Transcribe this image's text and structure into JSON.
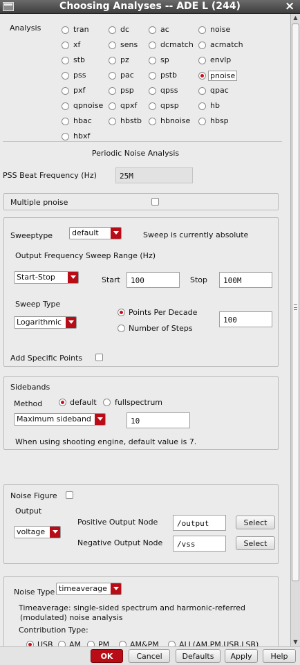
{
  "window": {
    "title": "Choosing Analyses -- ADE L (244)"
  },
  "analysis": {
    "label": "Analysis",
    "options": [
      "tran",
      "dc",
      "ac",
      "noise",
      "xf",
      "sens",
      "dcmatch",
      "acmatch",
      "stb",
      "pz",
      "sp",
      "envlp",
      "pss",
      "pac",
      "pstb",
      "pnoise",
      "pxf",
      "psp",
      "qpss",
      "qpac",
      "qpnoise",
      "qpxf",
      "qpsp",
      "hb",
      "hbac",
      "hbstb",
      "hbnoise",
      "hbsp",
      "hbxf"
    ],
    "selected": "pnoise"
  },
  "section_title": "Periodic Noise Analysis",
  "pss_beat": {
    "label": "PSS Beat Frequency (Hz)",
    "value": "25M"
  },
  "multiple_pnoise": {
    "label": "Multiple pnoise"
  },
  "sweep": {
    "sweeptype_label": "Sweeptype",
    "sweeptype_value": "default",
    "absolute_note": "Sweep is currently absolute",
    "range_label": "Output Frequency Sweep Range (Hz)",
    "range_mode": "Start-Stop",
    "start_label": "Start",
    "start_value": "100",
    "stop_label": "Stop",
    "stop_value": "100M",
    "sweep_type_label": "Sweep Type",
    "sweep_type_value": "Logarithmic",
    "ppd_label": "Points Per Decade",
    "steps_label": "Number of Steps",
    "points_value": "100",
    "specific_points_label": "Add Specific Points"
  },
  "sidebands": {
    "title": "Sidebands",
    "method_label": "Method",
    "method_default": "default",
    "method_full": "fullspectrum",
    "maxsb_mode": "Maximum sideband",
    "maxsb_value": "10",
    "note": "When using shooting engine, default value is 7."
  },
  "noise_figure": {
    "label": "Noise Figure",
    "output_label": "Output",
    "output_mode": "voltage",
    "pos_label": "Positive Output Node",
    "pos_value": "/output",
    "neg_label": "Negative Output Node",
    "neg_value": "/vss",
    "select_label": "Select"
  },
  "noise_type": {
    "label": "Noise Type",
    "value": "timeaverage",
    "desc_line1": "Timeaverage: single-sided spectrum and harmonic-referred",
    "desc_line2": "(modulated) noise analysis",
    "contrib_label": "Contribution Type:",
    "contrib_options": [
      "USB",
      "AM",
      "PM",
      "AM&PM",
      "ALL(AM,PM,USB,LSB)"
    ]
  },
  "buttons": {
    "ok": "OK",
    "cancel": "Cancel",
    "defaults": "Defaults",
    "apply": "Apply",
    "help": "Help"
  },
  "colors": {
    "accent": "#b80d16",
    "titlebar": "#4a4a4a",
    "background": "#ebebeb"
  }
}
